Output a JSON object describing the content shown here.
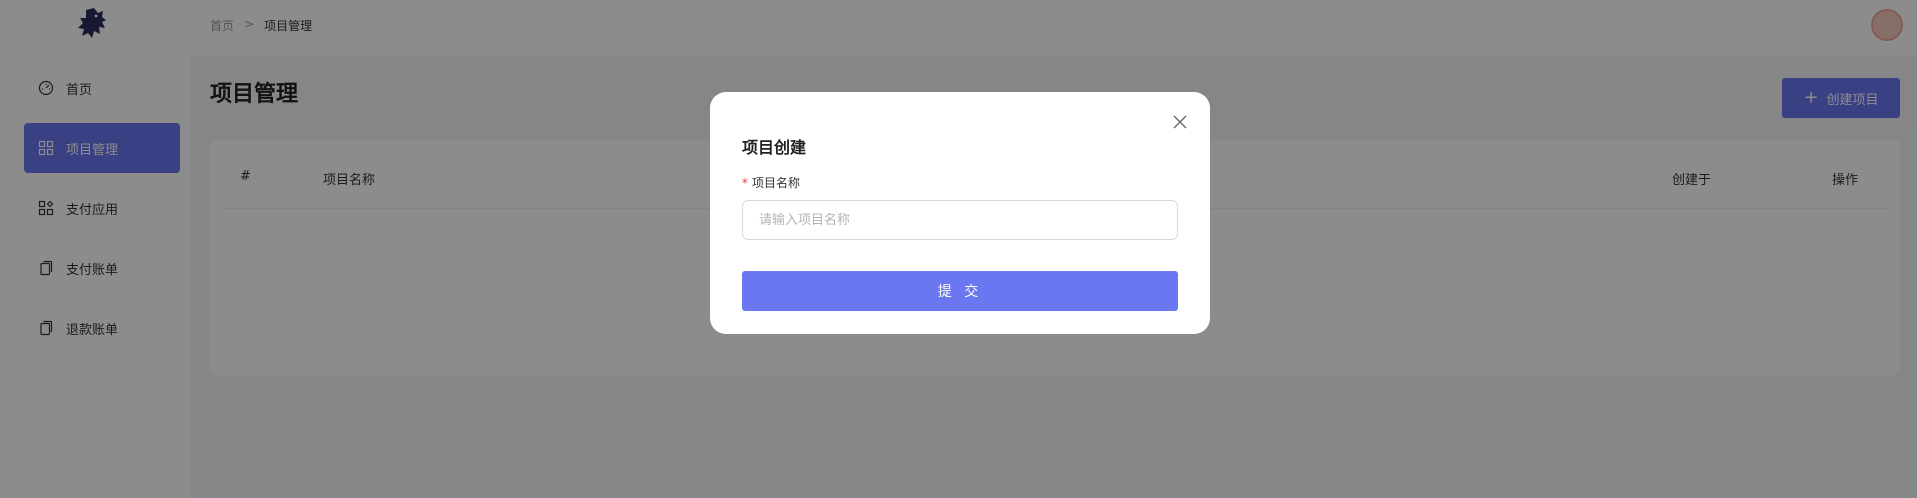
{
  "sidebar": {
    "logo": "dragon-logo",
    "items": [
      {
        "label": "首页",
        "icon": "dashboard-icon"
      },
      {
        "label": "项目管理",
        "icon": "grid-icon",
        "active": true
      },
      {
        "label": "支付应用",
        "icon": "apps-icon"
      },
      {
        "label": "支付账单",
        "icon": "copy-icon"
      },
      {
        "label": "退款账单",
        "icon": "copy-icon"
      }
    ]
  },
  "header": {
    "breadcrumb": {
      "home": "首页",
      "separator": ">",
      "current": "项目管理"
    },
    "avatar": "user-avatar"
  },
  "main": {
    "title": "项目管理",
    "create_button": "创建项目",
    "table": {
      "columns": [
        "#",
        "项目名称",
        "创建于",
        "操作"
      ]
    }
  },
  "modal": {
    "title": "项目创建",
    "field": {
      "required_mark": "*",
      "label": "项目名称",
      "placeholder": "请输入项目名称",
      "value": ""
    },
    "submit": "提 交"
  },
  "colors": {
    "accent": "#6b76f1",
    "overlay": "rgba(0,0,0,0.45)",
    "required": "#f23c3c"
  }
}
